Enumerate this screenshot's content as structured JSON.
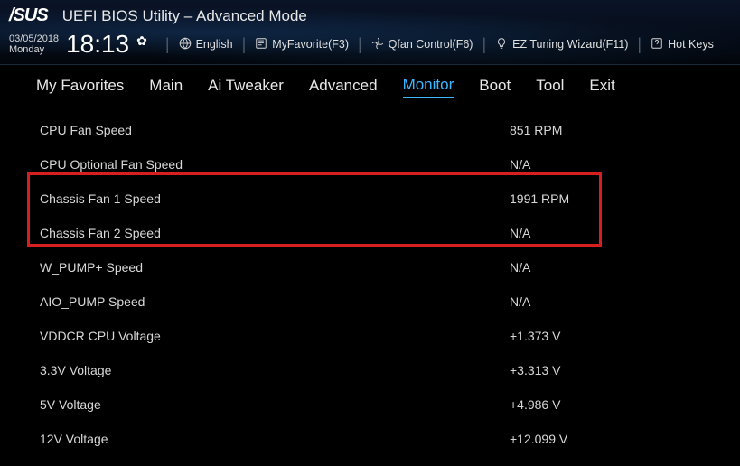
{
  "header": {
    "logo": "/SUS",
    "title": "UEFI BIOS Utility – Advanced Mode",
    "date": "03/05/2018",
    "day": "Monday",
    "time": "18:13",
    "toolbar": {
      "language": "English",
      "favorite": "MyFavorite(F3)",
      "qfan": "Qfan Control(F6)",
      "eztuning": "EZ Tuning Wizard(F11)",
      "hotkeys": "Hot Keys"
    }
  },
  "tabs": [
    {
      "label": "My Favorites",
      "active": false
    },
    {
      "label": "Main",
      "active": false
    },
    {
      "label": "Ai Tweaker",
      "active": false
    },
    {
      "label": "Advanced",
      "active": false
    },
    {
      "label": "Monitor",
      "active": true
    },
    {
      "label": "Boot",
      "active": false
    },
    {
      "label": "Tool",
      "active": false
    },
    {
      "label": "Exit",
      "active": false
    }
  ],
  "monitor_rows": [
    {
      "label": "CPU Fan Speed",
      "value": "851 RPM"
    },
    {
      "label": "CPU Optional Fan Speed",
      "value": "N/A"
    },
    {
      "label": "Chassis Fan 1 Speed",
      "value": "1991 RPM"
    },
    {
      "label": "Chassis Fan 2 Speed",
      "value": "N/A"
    },
    {
      "label": "W_PUMP+ Speed",
      "value": "N/A"
    },
    {
      "label": "AIO_PUMP Speed",
      "value": "N/A"
    },
    {
      "label": "VDDCR CPU Voltage",
      "value": "+1.373 V"
    },
    {
      "label": "3.3V Voltage",
      "value": "+3.313 V"
    },
    {
      "label": "5V Voltage",
      "value": "+4.986 V"
    },
    {
      "label": "12V Voltage",
      "value": "+12.099 V"
    }
  ]
}
